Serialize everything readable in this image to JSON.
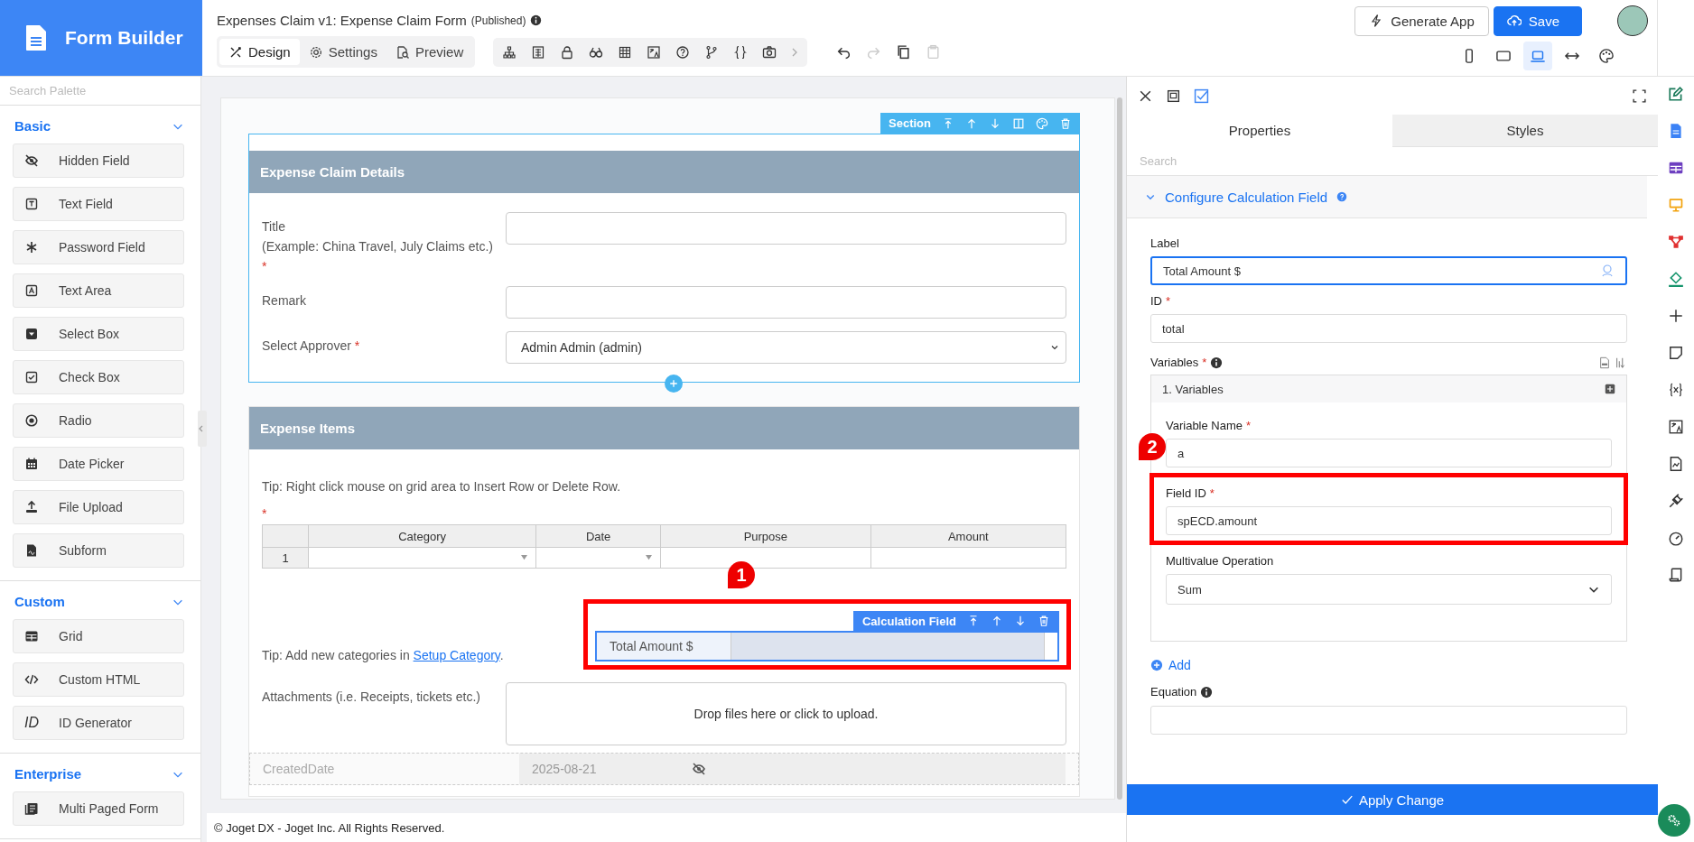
{
  "header": {
    "app_title": "Form Builder",
    "form_title": "Expenses Claim v1: Expense Claim Form",
    "form_status": "(Published)",
    "view_tabs": [
      {
        "label": "Design",
        "kind": "design",
        "selected": true
      },
      {
        "label": "Settings",
        "kind": "settings",
        "selected": false
      },
      {
        "label": "Preview",
        "kind": "preview",
        "selected": false
      }
    ],
    "edit_actions": [
      {
        "kind": "undo",
        "disabled": false
      },
      {
        "kind": "redo",
        "disabled": true
      },
      {
        "kind": "copy",
        "disabled": false
      },
      {
        "kind": "paste",
        "disabled": true
      }
    ],
    "buttons": [
      {
        "label": "Generate App",
        "kind": "generate"
      },
      {
        "label": "Save",
        "kind": "save"
      }
    ],
    "device_views": [
      {
        "kind": "phone",
        "selected": false
      },
      {
        "kind": "tablet",
        "selected": false
      },
      {
        "kind": "laptop",
        "selected": true
      },
      {
        "kind": "fit",
        "selected": false
      },
      {
        "kind": "theme",
        "selected": false
      }
    ]
  },
  "palette": {
    "search": {
      "placeholder": "Search Palette"
    },
    "groups": [
      {
        "title": "Basic",
        "expanded": true,
        "items": [
          {
            "label": "Hidden Field",
            "kind": "hidden"
          },
          {
            "label": "Text Field",
            "kind": "text"
          },
          {
            "label": "Password Field",
            "kind": "password"
          },
          {
            "label": "Text Area",
            "kind": "textarea"
          },
          {
            "label": "Select Box",
            "kind": "select"
          },
          {
            "label": "Check Box",
            "kind": "checkbox"
          },
          {
            "label": "Radio",
            "kind": "radio"
          },
          {
            "label": "Date Picker",
            "kind": "date"
          },
          {
            "label": "File Upload",
            "kind": "upload"
          },
          {
            "label": "Subform",
            "kind": "subform"
          }
        ]
      },
      {
        "title": "Custom",
        "expanded": true,
        "items": [
          {
            "label": "Grid",
            "kind": "grid"
          },
          {
            "label": "Custom HTML",
            "kind": "html"
          },
          {
            "label": "ID Generator",
            "kind": "id",
            "icon_text": "ID"
          }
        ]
      },
      {
        "title": "Enterprise",
        "expanded": true,
        "items": [
          {
            "label": "Multi Paged Form",
            "kind": "multipage"
          }
        ]
      }
    ]
  },
  "canvas": {
    "sections": [
      {
        "title": "Expense Claim Details",
        "selected": true,
        "toolbar_label": "Section",
        "fields": [
          {
            "kind": "text",
            "label": "Title",
            "hint": "(Example: China Travel, July Claims etc.)",
            "required_mark": "*"
          },
          {
            "kind": "text",
            "label": "Remark"
          },
          {
            "kind": "select",
            "label": "Select Approver",
            "required_mark": "*",
            "value": "Admin Admin (admin)"
          }
        ]
      },
      {
        "title": "Expense Items",
        "selected": false,
        "fields": [
          {
            "kind": "tip",
            "text": "Tip: Right click mouse on grid area to Insert Row or Delete Row."
          },
          {
            "kind": "grid",
            "required_mark": "*",
            "columns": [
              {
                "label": "Category",
                "dropdown": true
              },
              {
                "label": "Date",
                "dropdown": true
              },
              {
                "label": "Purpose",
                "dropdown": false
              },
              {
                "label": "Amount",
                "dropdown": false
              }
            ],
            "rows": [
              {
                "number": "1"
              }
            ]
          },
          {
            "kind": "tip_calc",
            "text": "Tip: Add new categories in ",
            "link": "Setup Category",
            "after": ".",
            "calc": {
              "label": "Total Amount $",
              "toolbar_label": "Calculation Field",
              "selected": true,
              "callout": "1"
            }
          },
          {
            "kind": "upload",
            "label": "Attachments (i.e. Receipts, tickets etc.)",
            "drop_text": "Drop files here or click to upload."
          },
          {
            "kind": "hidden",
            "label": "CreatedDate",
            "value": "2025-08-21"
          }
        ]
      }
    ],
    "footer": "© Joget DX - Joget Inc. All Rights Reserved."
  },
  "properties": {
    "tabs": [
      {
        "label": "Properties",
        "selected": true
      },
      {
        "label": "Styles",
        "selected": false
      }
    ],
    "search": {
      "placeholder": "Search"
    },
    "group": {
      "title": "Configure Calculation Field",
      "expanded": true
    },
    "label_field": {
      "label": "Label",
      "value": "Total Amount $",
      "focused": true
    },
    "id_field": {
      "label": "ID",
      "required_mark": "*",
      "value": "total"
    },
    "variables": {
      "label": "Variables",
      "required_mark": "*",
      "item_title": "1. Variables",
      "variable_name": {
        "label": "Variable Name",
        "required_mark": "*",
        "value": "a",
        "callout": "2"
      },
      "field_id": {
        "label": "Field ID",
        "required_mark": "*",
        "value": "spECD.amount",
        "highlighted": true
      },
      "operation": {
        "label": "Multivalue Operation",
        "value": "Sum"
      }
    },
    "add_link": "Add",
    "equation": {
      "label": "Equation"
    },
    "apply_button": "Apply Change"
  }
}
